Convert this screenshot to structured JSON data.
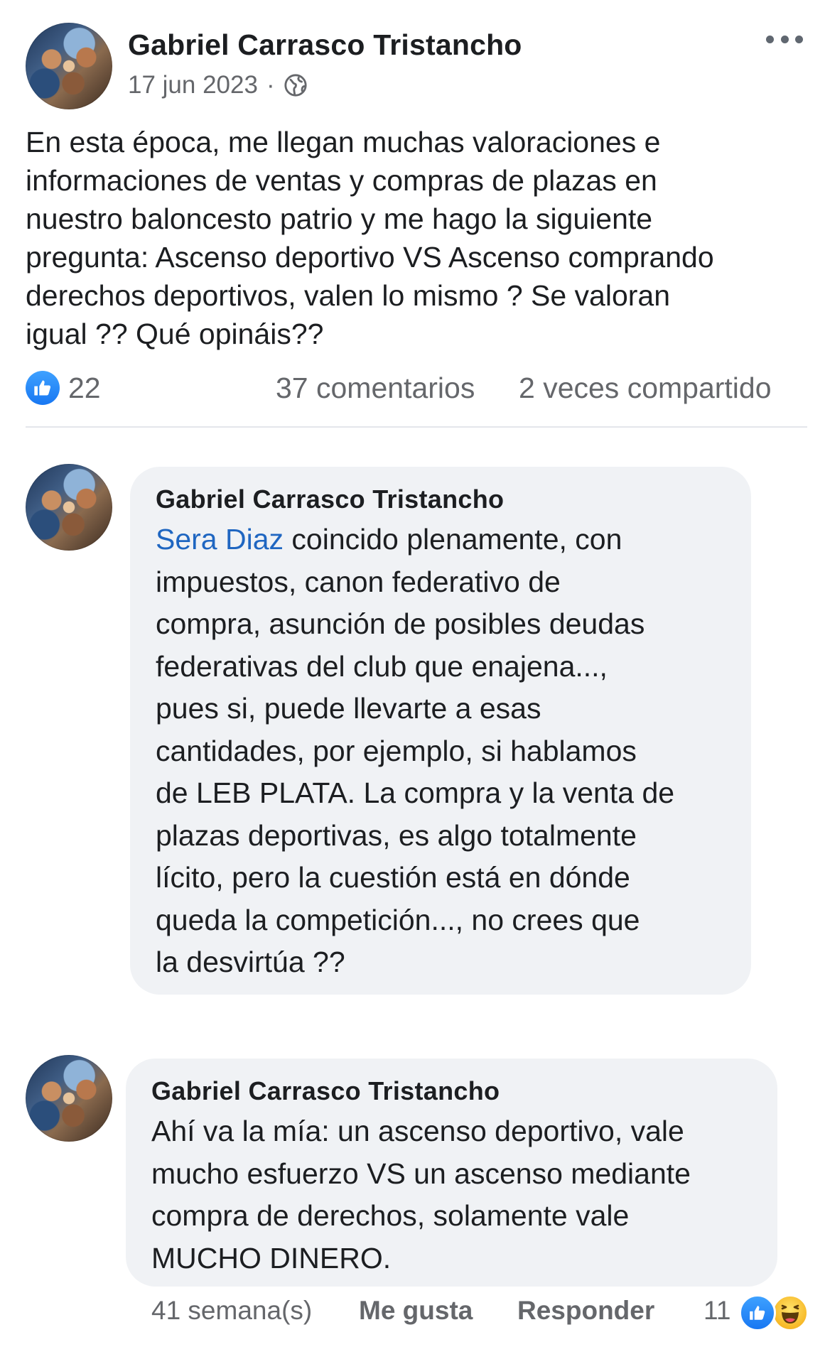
{
  "post": {
    "author": "Gabriel Carrasco Tristancho",
    "date": "17 jun 2023",
    "separator": "·",
    "privacy_icon": "globe-icon",
    "more_icon": "more-dots-icon",
    "text_lines": [
      "En esta época, me llegan muchas valoraciones e",
      "informaciones de ventas y compras de plazas en",
      "nuestro baloncesto patrio y me hago la siguiente",
      "pregunta: Ascenso deportivo VS Ascenso comprando",
      "derechos deportivos, valen lo mismo ? Se valoran",
      "igual ?? Qué opináis??"
    ],
    "reactions": {
      "icon": "like-icon",
      "count": "22"
    },
    "comments_count": "37 comentarios",
    "shares_count": "2 veces compartido"
  },
  "comments": [
    {
      "author": "Gabriel Carrasco Tristancho",
      "mention": "Sera Diaz",
      "text_lines": [
        " coincido plenamente, con",
        "impuestos, canon federativo de",
        "compra, asunción de posibles deudas",
        "federativas del club que enajena...,",
        "pues si, puede llevarte a esas",
        "cantidades, por ejemplo, si hablamos",
        "de LEB PLATA. La compra y la venta de",
        "plazas deportivas, es algo totalmente",
        "lícito, pero la cuestión está en dónde",
        "queda la competición..., no crees que",
        "la desvirtúa ??"
      ]
    },
    {
      "author": "Gabriel Carrasco Tristancho",
      "text_lines": [
        "Ahí va la mía: un ascenso deportivo, vale",
        "mucho esfuerzo VS un ascenso mediante",
        "compra de derechos, solamente vale",
        "MUCHO DINERO."
      ],
      "footer": {
        "time": "41 semana(s)",
        "like_label": "Me gusta",
        "reply_label": "Responder",
        "reaction_count": "11",
        "reaction_icons": [
          "like-icon",
          "haha-icon"
        ]
      }
    }
  ],
  "colors": {
    "facebook_blue": "#1877f2",
    "bubble_bg": "#f0f2f5",
    "secondary_text": "#65676b",
    "mention": "#1f66c1"
  }
}
